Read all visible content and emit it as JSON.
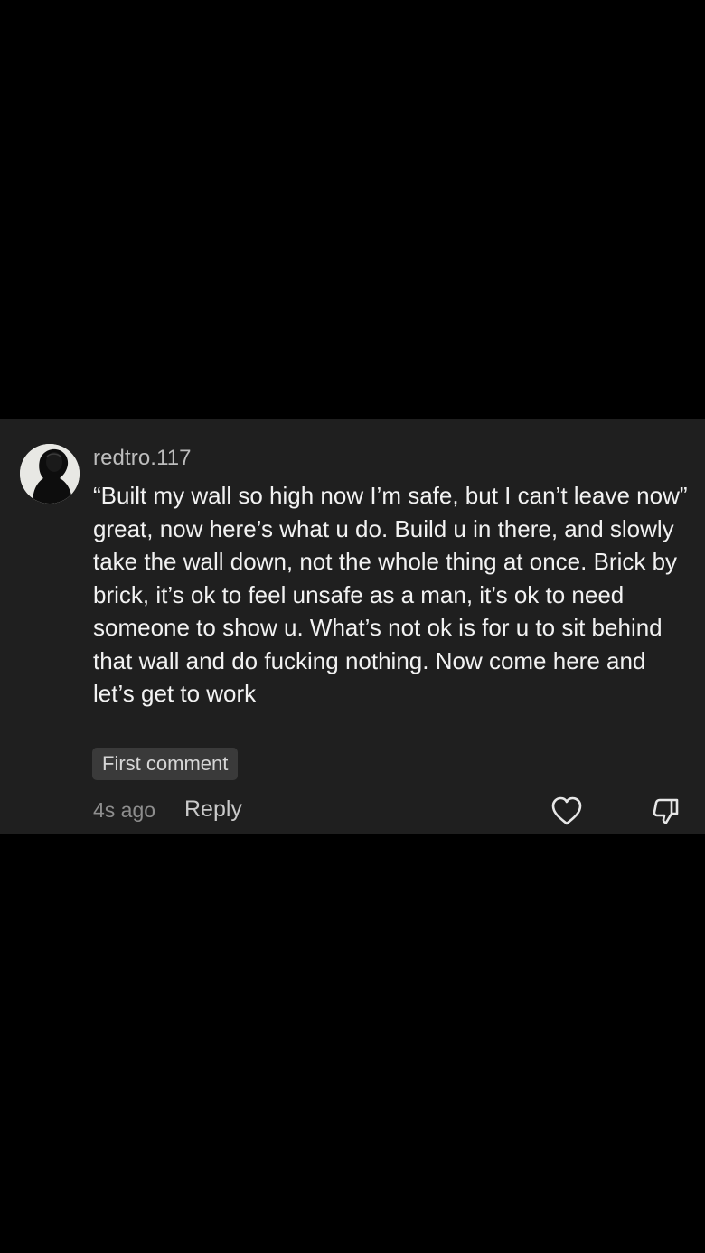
{
  "comment": {
    "username": "redtro.117",
    "text": "“Built my wall so high now I’m safe, but I can’t leave now” great, now here’s what u do. Build u in there, and slowly take the wall down, not the whole thing at once. Brick by brick, it’s ok to feel unsafe as a man, it’s ok to need someone to show u. What’s not ok is for u to sit behind that wall and do fucking nothing. Now come here and let’s get to work",
    "badge": "First comment",
    "timestamp": "4s ago",
    "reply_label": "Reply",
    "like_icon": "heart-icon",
    "dislike_icon": "thumbs-down-icon"
  },
  "colors": {
    "page_background": "#000000",
    "card_background": "#1f1f1f",
    "text_primary": "#f2f2f2",
    "text_secondary": "#8e8e8e",
    "badge_background": "#3a3a3a"
  }
}
